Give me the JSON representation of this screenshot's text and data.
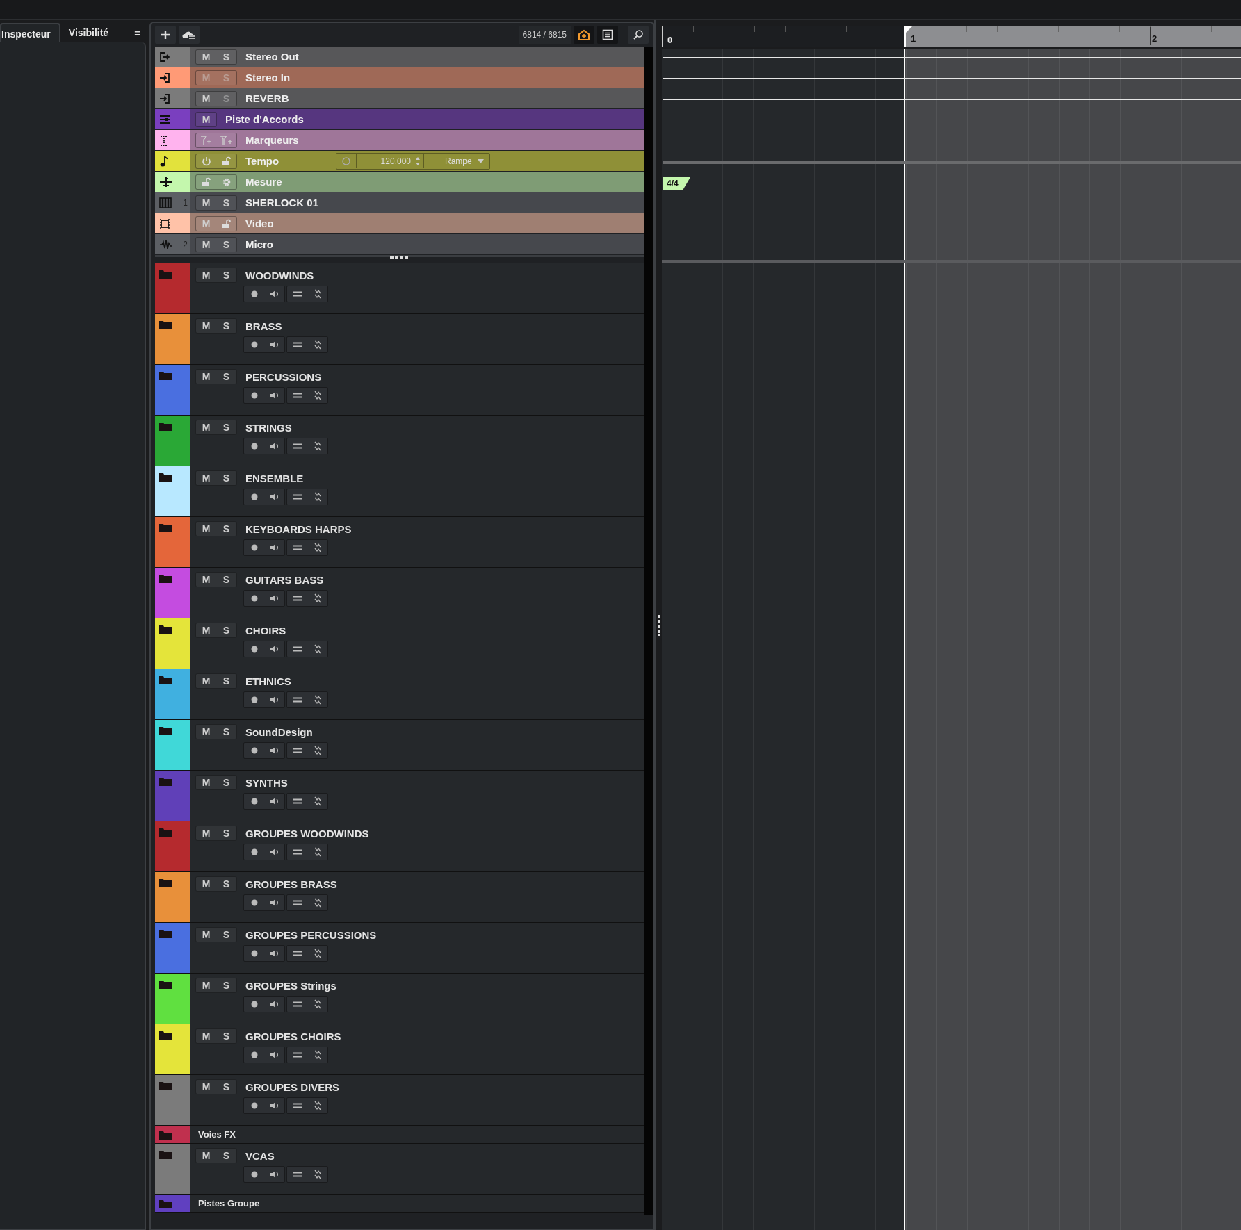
{
  "tabs": [
    {
      "label": "Inspecteur",
      "selected": true
    },
    {
      "label": "Visibilité",
      "selected": false
    }
  ],
  "tab_menu": "=",
  "toolbar": {
    "counter": "6814 / 6815"
  },
  "global_tracks": [
    {
      "kind": "output",
      "name": "Stereo Out",
      "color": "#7b7b7b",
      "buttons": [
        {
          "label": "M",
          "disabled": false
        },
        {
          "label": "S",
          "disabled": false
        }
      ]
    },
    {
      "kind": "input",
      "name": "Stereo In",
      "color": "#ff9a76",
      "buttons": [
        {
          "label": "M",
          "disabled": true
        },
        {
          "label": "S",
          "disabled": true
        }
      ]
    },
    {
      "kind": "fx",
      "name": "REVERB",
      "color": "#7b7b7b",
      "buttons": [
        {
          "label": "M",
          "disabled": false
        },
        {
          "label": "S",
          "disabled": true
        }
      ]
    },
    {
      "kind": "chord",
      "name": "Piste d'Accords",
      "color": "#7a3fbf",
      "buttons": [
        {
          "label": "M",
          "disabled": false
        }
      ]
    },
    {
      "kind": "marker",
      "name": "Marqueurs",
      "color": "#ffb3ee"
    },
    {
      "kind": "tempo",
      "name": "Tempo",
      "color": "#e2e23c",
      "tempo": "120.000",
      "mode": "Rampe"
    },
    {
      "kind": "signature",
      "name": "Mesure",
      "color": "#c4f7ad"
    },
    {
      "kind": "instrument",
      "name": "SHERLOCK 01",
      "color": "#5c5f64",
      "number": "1",
      "buttons": [
        {
          "label": "M",
          "disabled": false
        },
        {
          "label": "S",
          "disabled": false
        }
      ]
    },
    {
      "kind": "video",
      "name": "Video",
      "color": "#ffc2a8",
      "buttons": [
        {
          "label": "M",
          "disabled": false
        }
      ]
    },
    {
      "kind": "audio",
      "name": "Micro",
      "color": "#5c5f64",
      "number": "2",
      "buttons": [
        {
          "label": "M",
          "disabled": false
        },
        {
          "label": "S",
          "disabled": false
        }
      ]
    }
  ],
  "folders": [
    {
      "kind": "full",
      "name": "WOODWINDS",
      "color": "#b52a2e",
      "buttons": [
        "M",
        "S"
      ]
    },
    {
      "kind": "full",
      "name": "BRASS",
      "color": "#e8903a",
      "buttons": [
        "M",
        "S"
      ]
    },
    {
      "kind": "full",
      "name": "PERCUSSIONS",
      "color": "#4a6fe0",
      "buttons": [
        "M",
        "S"
      ]
    },
    {
      "kind": "full",
      "name": "STRINGS",
      "color": "#2aa836",
      "buttons": [
        "M",
        "S"
      ]
    },
    {
      "kind": "full",
      "name": "ENSEMBLE",
      "color": "#b8e8ff",
      "buttons": [
        "M",
        "S"
      ]
    },
    {
      "kind": "full",
      "name": "KEYBOARDS HARPS",
      "color": "#e4663a",
      "buttons": [
        "M",
        "S"
      ]
    },
    {
      "kind": "full",
      "name": "GUITARS BASS",
      "color": "#c44ce0",
      "buttons": [
        "M",
        "S"
      ]
    },
    {
      "kind": "full",
      "name": "CHOIRS",
      "color": "#e4e43a",
      "buttons": [
        "M",
        "S"
      ]
    },
    {
      "kind": "full",
      "name": "ETHNICS",
      "color": "#40b0e0",
      "buttons": [
        "M",
        "S"
      ]
    },
    {
      "kind": "full",
      "name": "SoundDesign",
      "color": "#40d8d8",
      "buttons": [
        "M",
        "S"
      ]
    },
    {
      "kind": "full",
      "name": "SYNTHS",
      "color": "#6040b8",
      "buttons": [
        "M",
        "S"
      ]
    },
    {
      "kind": "full",
      "name": "GROUPES WOODWINDS",
      "color": "#b52a2e",
      "buttons": [
        "M",
        "S"
      ]
    },
    {
      "kind": "full",
      "name": "GROUPES BRASS",
      "color": "#e8903a",
      "buttons": [
        "M",
        "S"
      ]
    },
    {
      "kind": "full",
      "name": "GROUPES PERCUSSIONS",
      "color": "#4a6fe0",
      "buttons": [
        "M",
        "S"
      ]
    },
    {
      "kind": "full",
      "name": "GROUPES Strings",
      "color": "#60e040",
      "buttons": [
        "M",
        "S"
      ]
    },
    {
      "kind": "full",
      "name": "GROUPES CHOIRS",
      "color": "#e4e43a",
      "buttons": [
        "M",
        "S"
      ]
    },
    {
      "kind": "full",
      "name": "GROUPES DIVERS",
      "color": "#7b7b7b",
      "buttons": [
        "M",
        "S"
      ]
    },
    {
      "kind": "compact",
      "name": "Voies FX",
      "color": "#c0304e"
    },
    {
      "kind": "full",
      "name": "VCAS",
      "color": "#7b7b7b",
      "buttons": [
        "M",
        "S"
      ]
    },
    {
      "kind": "compact",
      "name": "Pistes Groupe",
      "color": "#6040c0"
    }
  ],
  "ruler": {
    "bars": [
      "0",
      "1",
      "2"
    ],
    "signature": "4/4"
  }
}
